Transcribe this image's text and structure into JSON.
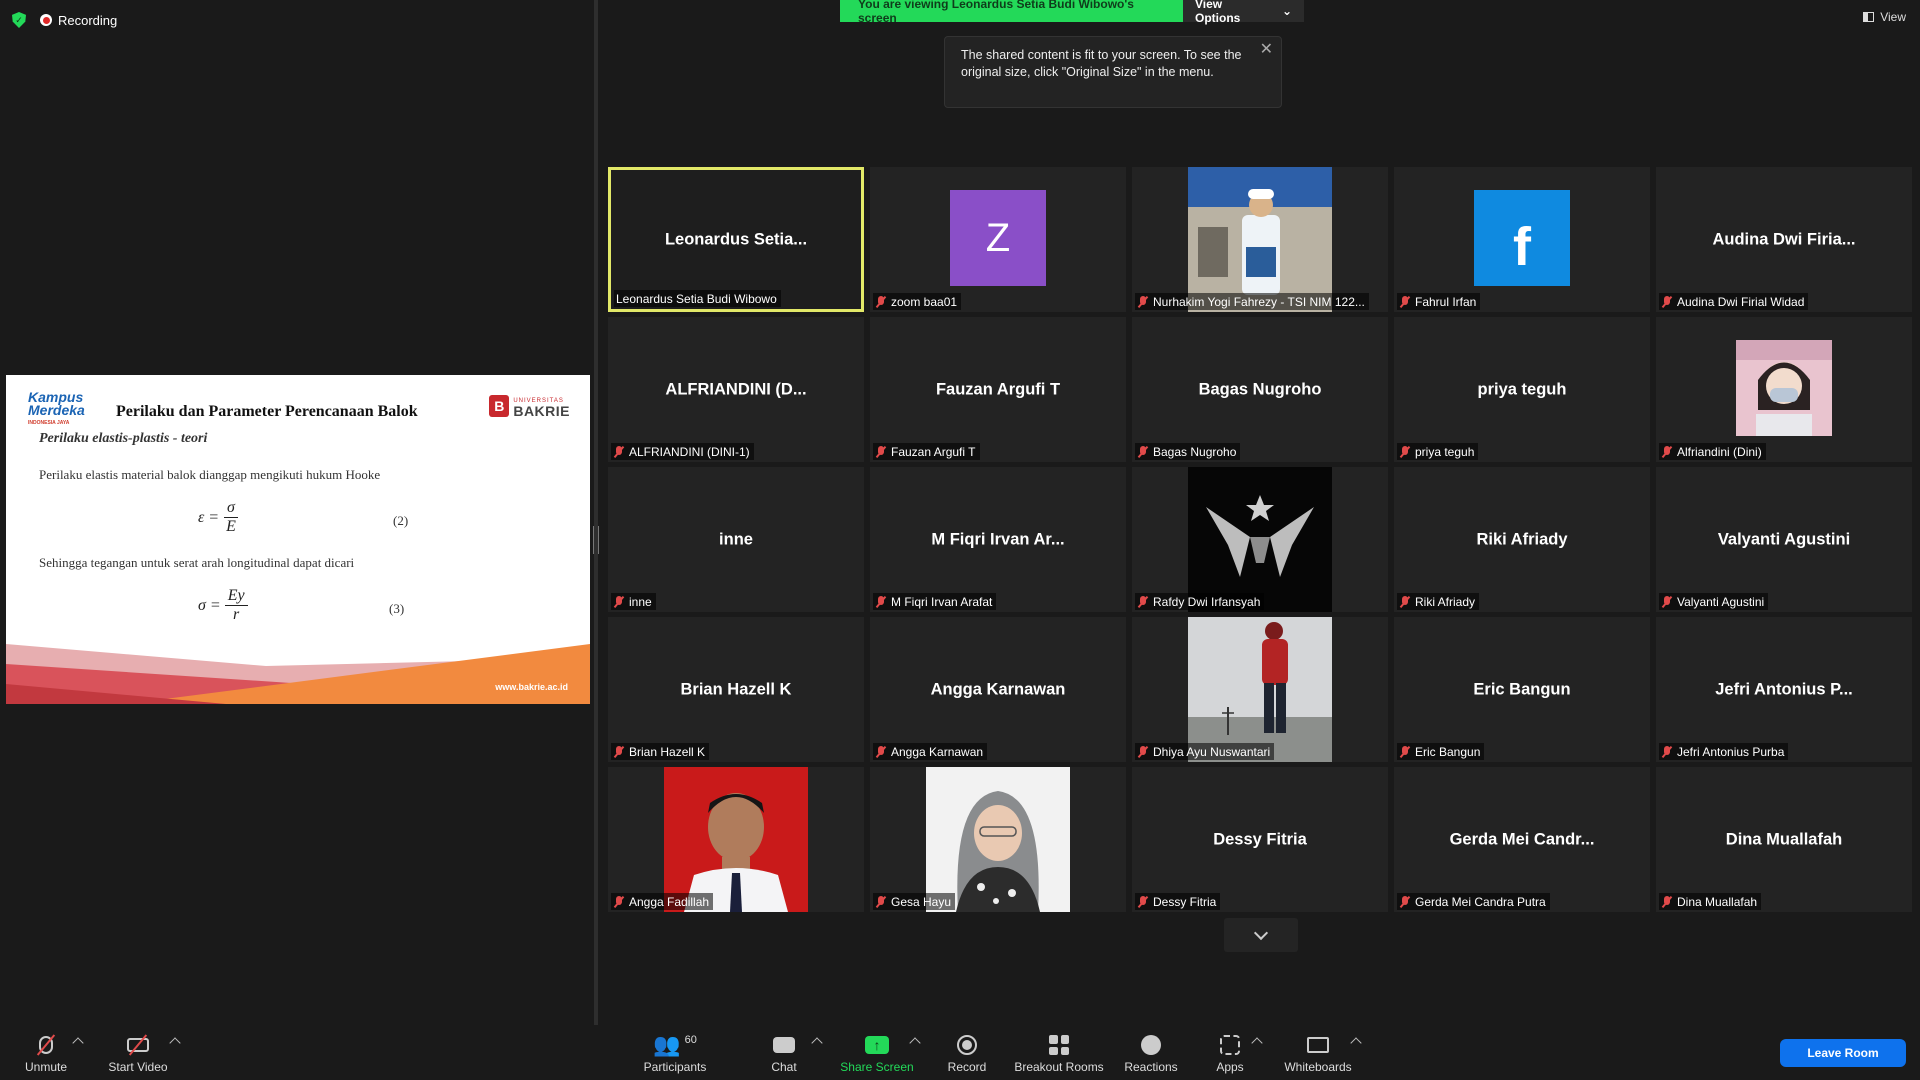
{
  "status": {
    "recording": "Recording"
  },
  "banner": {
    "viewing": "You are viewing Leonardus Setia Budi Wibowo's screen",
    "view_options": "View Options"
  },
  "view_button": "View",
  "tooltip": {
    "line1": "The shared content is fit to your screen. To see the",
    "line2": "original size, click \"Original Size\" in the menu."
  },
  "slide": {
    "logo_left_1": "Kampus",
    "logo_left_2": "Merdeka",
    "logo_left_3": "INDONESIA JAYA",
    "title": "Perilaku dan Parameter Perencanaan Balok",
    "logo_right_top": "UNIVERSITAS",
    "logo_right_name": "BAKRIE",
    "subtitle": "Perilaku elastis-plastis - teori",
    "para1": "Perilaku elastis material balok dianggap mengikuti hukum Hooke",
    "eq1_lhs": "ε =",
    "eq1_num": "σ",
    "eq1_den": "E",
    "eq1_no": "(2)",
    "para2": "Sehingga tegangan untuk serat arah longitudinal dapat dicari",
    "eq2_lhs": "σ =",
    "eq2_num": "Ey",
    "eq2_den": "r",
    "eq2_no": "(3)",
    "url": "www.bakrie.ac.id"
  },
  "participants": [
    {
      "center": "Leonardus  Setia...",
      "label": "Leonardus Setia Budi Wibowo",
      "muted": false,
      "active": true
    },
    {
      "avatar_letter": "Z",
      "label": "zoom baa01",
      "muted": true
    },
    {
      "photo": "construction",
      "label": "Nurhakim Yogi Fahrezy - TSI NIM 122...",
      "muted": true
    },
    {
      "avatar_fb": "f",
      "label": "Fahrul Irfan",
      "muted": true
    },
    {
      "center": "Audina  Dwi  Firia...",
      "label": "Audina Dwi Firial Widad",
      "muted": true
    },
    {
      "center": "ALFRIANDINI  (D...",
      "label": "ALFRIANDINI (DINI-1)",
      "muted": true
    },
    {
      "center": "Fauzan Argufi T",
      "label": "Fauzan Argufi T",
      "muted": true
    },
    {
      "center": "Bagas Nugroho",
      "label": "Bagas Nugroho",
      "muted": true
    },
    {
      "center": "priya teguh",
      "label": "priya teguh",
      "muted": true
    },
    {
      "photo": "masked",
      "label": "Alfriandini (Dini)",
      "muted": true
    },
    {
      "center": "inne",
      "label": "inne",
      "muted": true
    },
    {
      "center": "M  Fiqri  Irvan  Ar...",
      "label": "M Fiqri Irvan Arafat",
      "muted": true
    },
    {
      "photo": "logo",
      "label": "Rafdy Dwi Irfansyah",
      "muted": true
    },
    {
      "center": "Riki Afriady",
      "label": "Riki Afriady",
      "muted": true
    },
    {
      "center": "Valyanti Agustini",
      "label": "Valyanti Agustini",
      "muted": true
    },
    {
      "center": "Brian Hazell K",
      "label": "Brian Hazell K",
      "muted": true
    },
    {
      "center": "Angga Karnawan",
      "label": "Angga Karnawan",
      "muted": true
    },
    {
      "photo": "sky",
      "label": "Dhiya Ayu Nuswantari",
      "muted": true
    },
    {
      "center": "Eric Bangun",
      "label": "Eric Bangun",
      "muted": true
    },
    {
      "center": "Jefri  Antonius  P...",
      "label": "Jefri Antonius Purba",
      "muted": true
    },
    {
      "photo": "red",
      "label": "Angga Fadillah",
      "muted": true
    },
    {
      "photo": "hijab",
      "label": "Gesa Hayu",
      "muted": true
    },
    {
      "center": "Dessy Fitria",
      "label": "Dessy Fitria",
      "muted": true
    },
    {
      "center": "Gerda  Mei  Candr...",
      "label": "Gerda Mei Candra Putra",
      "muted": true
    },
    {
      "center": "Dina Muallafah",
      "label": "Dina Muallafah",
      "muted": true
    }
  ],
  "toolbar": {
    "unmute": "Unmute",
    "start_video": "Start Video",
    "participants": "Participants",
    "participants_count": "60",
    "chat": "Chat",
    "share_screen": "Share Screen",
    "record": "Record",
    "breakout": "Breakout Rooms",
    "reactions": "Reactions",
    "apps": "Apps",
    "whiteboards": "Whiteboards",
    "leave": "Leave Room"
  },
  "colors": {
    "accent_green": "#23d959",
    "active_border": "#e2e868",
    "leave_blue": "#0e72ed",
    "muted_red": "#e04a4a"
  }
}
